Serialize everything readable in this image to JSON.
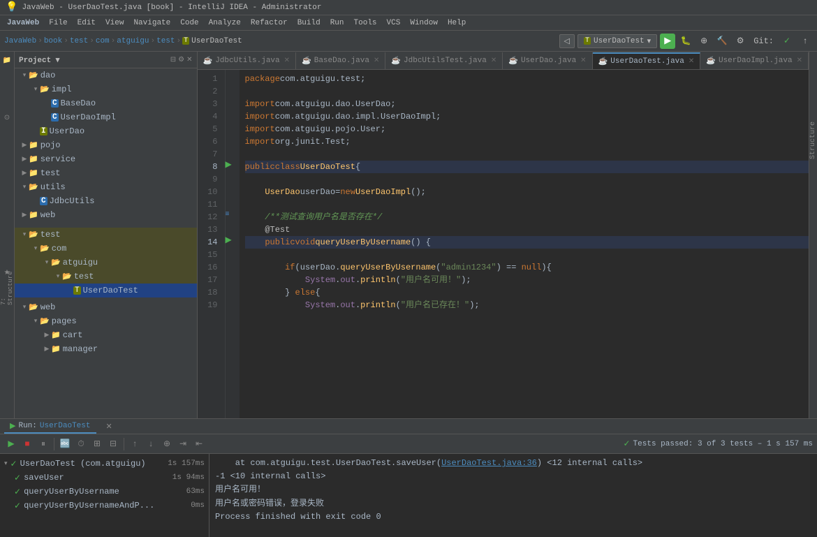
{
  "titleBar": {
    "title": "JavaWeb - UserDaoTest.java [book] - IntelliJ IDEA - Administrator"
  },
  "menuBar": {
    "items": [
      "JavaWeb",
      "File",
      "Edit",
      "View",
      "Navigate",
      "Code",
      "Analyze",
      "Refactor",
      "Build",
      "Run",
      "Tools",
      "VCS",
      "Window",
      "Help"
    ]
  },
  "toolbar": {
    "breadcrumb": [
      "JavaWeb",
      "book",
      "test",
      "com",
      "atguigu",
      "test",
      "UserDaoTest"
    ],
    "runConfig": "UserDaoTest",
    "gitLabel": "Git:"
  },
  "tabs": [
    {
      "label": "JdbcUtils.java",
      "active": false,
      "modified": false
    },
    {
      "label": "BaseDao.java",
      "active": false,
      "modified": false
    },
    {
      "label": "JdbcUtilsTest.java",
      "active": false,
      "modified": false
    },
    {
      "label": "UserDao.java",
      "active": false,
      "modified": false
    },
    {
      "label": "UserDaoTest.java",
      "active": true,
      "modified": false
    },
    {
      "label": "UserDaoImpl.java",
      "active": false,
      "modified": false
    }
  ],
  "projectTree": {
    "items": [
      {
        "label": "dao",
        "type": "folder",
        "indent": 0,
        "expanded": true
      },
      {
        "label": "impl",
        "type": "folder",
        "indent": 1,
        "expanded": true
      },
      {
        "label": "BaseDao",
        "type": "class",
        "indent": 2
      },
      {
        "label": "UserDaoImpl",
        "type": "class",
        "indent": 2
      },
      {
        "label": "UserDao",
        "type": "interface",
        "indent": 1
      },
      {
        "label": "pojo",
        "type": "folder",
        "indent": 0,
        "expanded": false
      },
      {
        "label": "service",
        "type": "folder",
        "indent": 0,
        "expanded": false
      },
      {
        "label": "test",
        "type": "folder",
        "indent": 0,
        "expanded": false
      },
      {
        "label": "utils",
        "type": "folder",
        "indent": 0,
        "expanded": true
      },
      {
        "label": "JdbcUtils",
        "type": "class",
        "indent": 1
      },
      {
        "label": "web",
        "type": "folder",
        "indent": 0,
        "expanded": false
      }
    ],
    "testItems": [
      {
        "label": "test",
        "type": "folder",
        "indent": 0,
        "expanded": true
      },
      {
        "label": "com",
        "type": "folder",
        "indent": 1,
        "expanded": true
      },
      {
        "label": "atguigu",
        "type": "folder",
        "indent": 2,
        "expanded": true
      },
      {
        "label": "test",
        "type": "folder",
        "indent": 3,
        "expanded": true,
        "selected": true
      },
      {
        "label": "UserDaoTest",
        "type": "testclass",
        "indent": 4,
        "selected": true
      }
    ],
    "webItems": [
      {
        "label": "web",
        "type": "folder",
        "indent": 0,
        "expanded": true
      },
      {
        "label": "pages",
        "type": "folder",
        "indent": 1,
        "expanded": true
      },
      {
        "label": "cart",
        "type": "folder",
        "indent": 2,
        "expanded": false
      },
      {
        "label": "manager",
        "type": "folder",
        "indent": 2,
        "expanded": false
      }
    ]
  },
  "codeLines": [
    {
      "num": 1,
      "code": "package com.atguigu.test;"
    },
    {
      "num": 2,
      "code": ""
    },
    {
      "num": 3,
      "code": "import com.atguigu.dao.UserDao;"
    },
    {
      "num": 4,
      "code": "import com.atguigu.dao.impl.UserDaoImpl;"
    },
    {
      "num": 5,
      "code": "import com.atguigu.pojo.User;"
    },
    {
      "num": 6,
      "code": "import org.junit.Test;"
    },
    {
      "num": 7,
      "code": ""
    },
    {
      "num": 8,
      "code": "public class UserDaoTest {",
      "gutter": "arrow"
    },
    {
      "num": 9,
      "code": ""
    },
    {
      "num": 10,
      "code": "    UserDao userDao = new UserDaoImpl();"
    },
    {
      "num": 11,
      "code": ""
    },
    {
      "num": 12,
      "code": "    /**测试查询用户名是否存在*/"
    },
    {
      "num": 13,
      "code": "    @Test"
    },
    {
      "num": 14,
      "code": "    public void queryUserByUsername() {",
      "gutter": "arrow"
    },
    {
      "num": 15,
      "code": ""
    },
    {
      "num": 16,
      "code": "        if (userDao.queryUserByUsername(\"admin1234\") == null ){"
    },
    {
      "num": 17,
      "code": "            System.out.println(\"用户名可用！\");"
    },
    {
      "num": 18,
      "code": "        } else {"
    },
    {
      "num": 19,
      "code": "            System.out.println(\"用户名已存在！\");"
    }
  ],
  "runPanel": {
    "tabLabel": "Run:",
    "testName": "UserDaoTest",
    "statusLine": "Tests passed: 3 of 3 tests – 1 s 157 ms",
    "results": [
      {
        "label": "UserDaoTest (com.atguigu)",
        "time": "1s 157ms",
        "pass": true,
        "indent": 0
      },
      {
        "label": "saveUser",
        "time": "1s 94ms",
        "pass": true,
        "indent": 1
      },
      {
        "label": "queryUserByUsername",
        "time": "63ms",
        "pass": true,
        "indent": 1
      },
      {
        "label": "queryUserByUsernameAndP...",
        "time": "0ms",
        "pass": true,
        "indent": 1
      }
    ],
    "outputLines": [
      {
        "text": "    at com.atguigu.test.UserDaoTest.saveUser(UserDaoTest.java:36) <12 internal calls>"
      },
      {
        "text": "-1  <10 internal calls>"
      },
      {
        "text": "用户名可用！"
      },
      {
        "text": "用户名或密码错误，登录失败"
      },
      {
        "text": ""
      },
      {
        "text": "Process finished with exit code 0"
      }
    ]
  }
}
